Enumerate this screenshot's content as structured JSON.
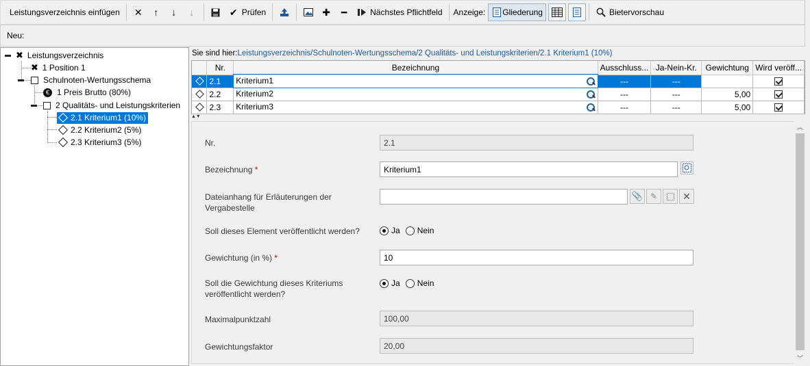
{
  "toolbar": {
    "insert_label": "Leistungsverzeichnis einfügen",
    "check_label": "Prüfen",
    "next_required_label": "Nächstes Pflichtfeld",
    "display_label": "Anzeige:",
    "outline_label": "Gliederung",
    "bidder_preview_label": "Bietervorschau"
  },
  "neu_label": "Neu:",
  "tree": {
    "root": "Leistungsverzeichnis",
    "position1": "1 Position 1",
    "schema": "Schulnoten-Wertungsschema",
    "preis": "1 Preis Brutto (80%)",
    "quali": "2 Qualitäts- und Leistungskriterien",
    "k1": "2.1 Kriterium1 (10%)",
    "k2": "2.2 Kriterium2 (5%)",
    "k3": "2.3 Kriterium3 (5%)"
  },
  "breadcrumb": {
    "prefix": "Sie sind hier:",
    "p1": "Leistungsverzeichnis",
    "p2": "Schulnoten-Wertungsschema",
    "p3": "2 Qualitäts- und Leistungskriterien",
    "p4": "2.1 Kriterium1 (10%)",
    "sep": "/"
  },
  "grid": {
    "headers": {
      "nr": "Nr.",
      "bez": "Bezeichnung",
      "aus": "Ausschluss...",
      "jn": "Ja-Nein-Kr.",
      "gew": "Gewichtung",
      "ver": "Wird veröff..."
    },
    "rows": [
      {
        "nr": "2.1",
        "bez": "Kriterium1",
        "aus": "---",
        "jn": "---",
        "gew": ""
      },
      {
        "nr": "2.2",
        "bez": "Kriterium2",
        "aus": "---",
        "jn": "---",
        "gew": "5,00"
      },
      {
        "nr": "2.3",
        "bez": "Kriterium3",
        "aus": "---",
        "jn": "---",
        "gew": "5,00"
      }
    ]
  },
  "form": {
    "nr_label": "Nr.",
    "nr_value": "2.1",
    "bez_label": "Bezeichnung",
    "bez_value": "Kriterium1",
    "anhang_label_1": "Dateianhang für Erläuterungen der",
    "anhang_label_2": "Vergabestelle",
    "publish_label": "Soll dieses Element veröffentlicht werden?",
    "ja": "Ja",
    "nein": "Nein",
    "gew_label": "Gewichtung (in %)",
    "gew_value": "10",
    "gew_pub_label_1": "Soll die Gewichtung dieses Kriteriums",
    "gew_pub_label_2": "veröffentlicht werden?",
    "max_label": "Maximalpunktzahl",
    "max_value": "100,00",
    "faktor_label": "Gewichtungsfaktor",
    "faktor_value": "20,00",
    "required_mark": "*"
  },
  "colors": {
    "selection": "#0078d7",
    "link": "#1e5aa0",
    "required": "#cc0000"
  }
}
